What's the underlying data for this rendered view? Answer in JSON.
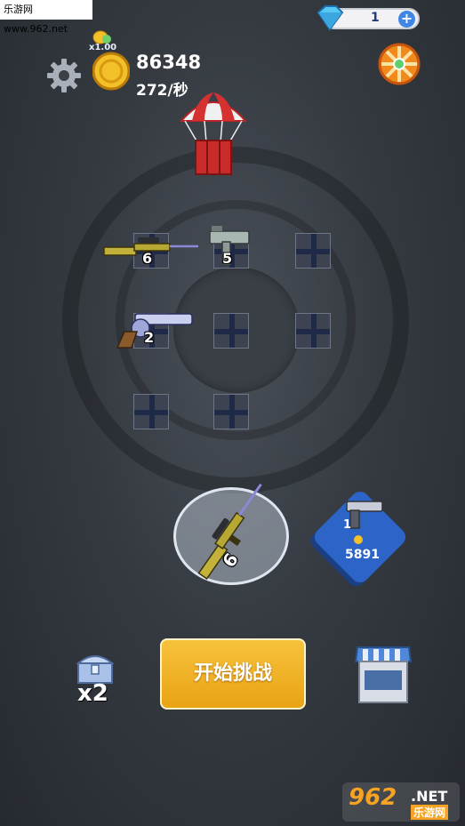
{
  "watermark": {
    "text": "乐游网 www.962.net"
  },
  "currency": {
    "gems": "1",
    "coins": "86348",
    "rate": "272/秒",
    "multiplier": "x1.00"
  },
  "grid_weapons": [
    {
      "level": "6",
      "kind": "sniper-rifle"
    },
    {
      "level": "5",
      "kind": "uzi"
    },
    {
      "level": "2",
      "kind": "revolver"
    }
  ],
  "selected_weapon": {
    "level": "6",
    "kind": "sniper-rifle"
  },
  "buy_weapon": {
    "level": "1",
    "price": "5891"
  },
  "actions": {
    "start_label": "开始挑战",
    "chest_multiplier": "x2"
  },
  "logo": {
    "main": "962",
    "net": ".NET",
    "sub": "乐游网"
  },
  "colors": {
    "start_button": "#f0b024",
    "buy_tile": "#2d64c7",
    "gem_plus": "#3f86e6",
    "coin": "#f3c02a"
  }
}
